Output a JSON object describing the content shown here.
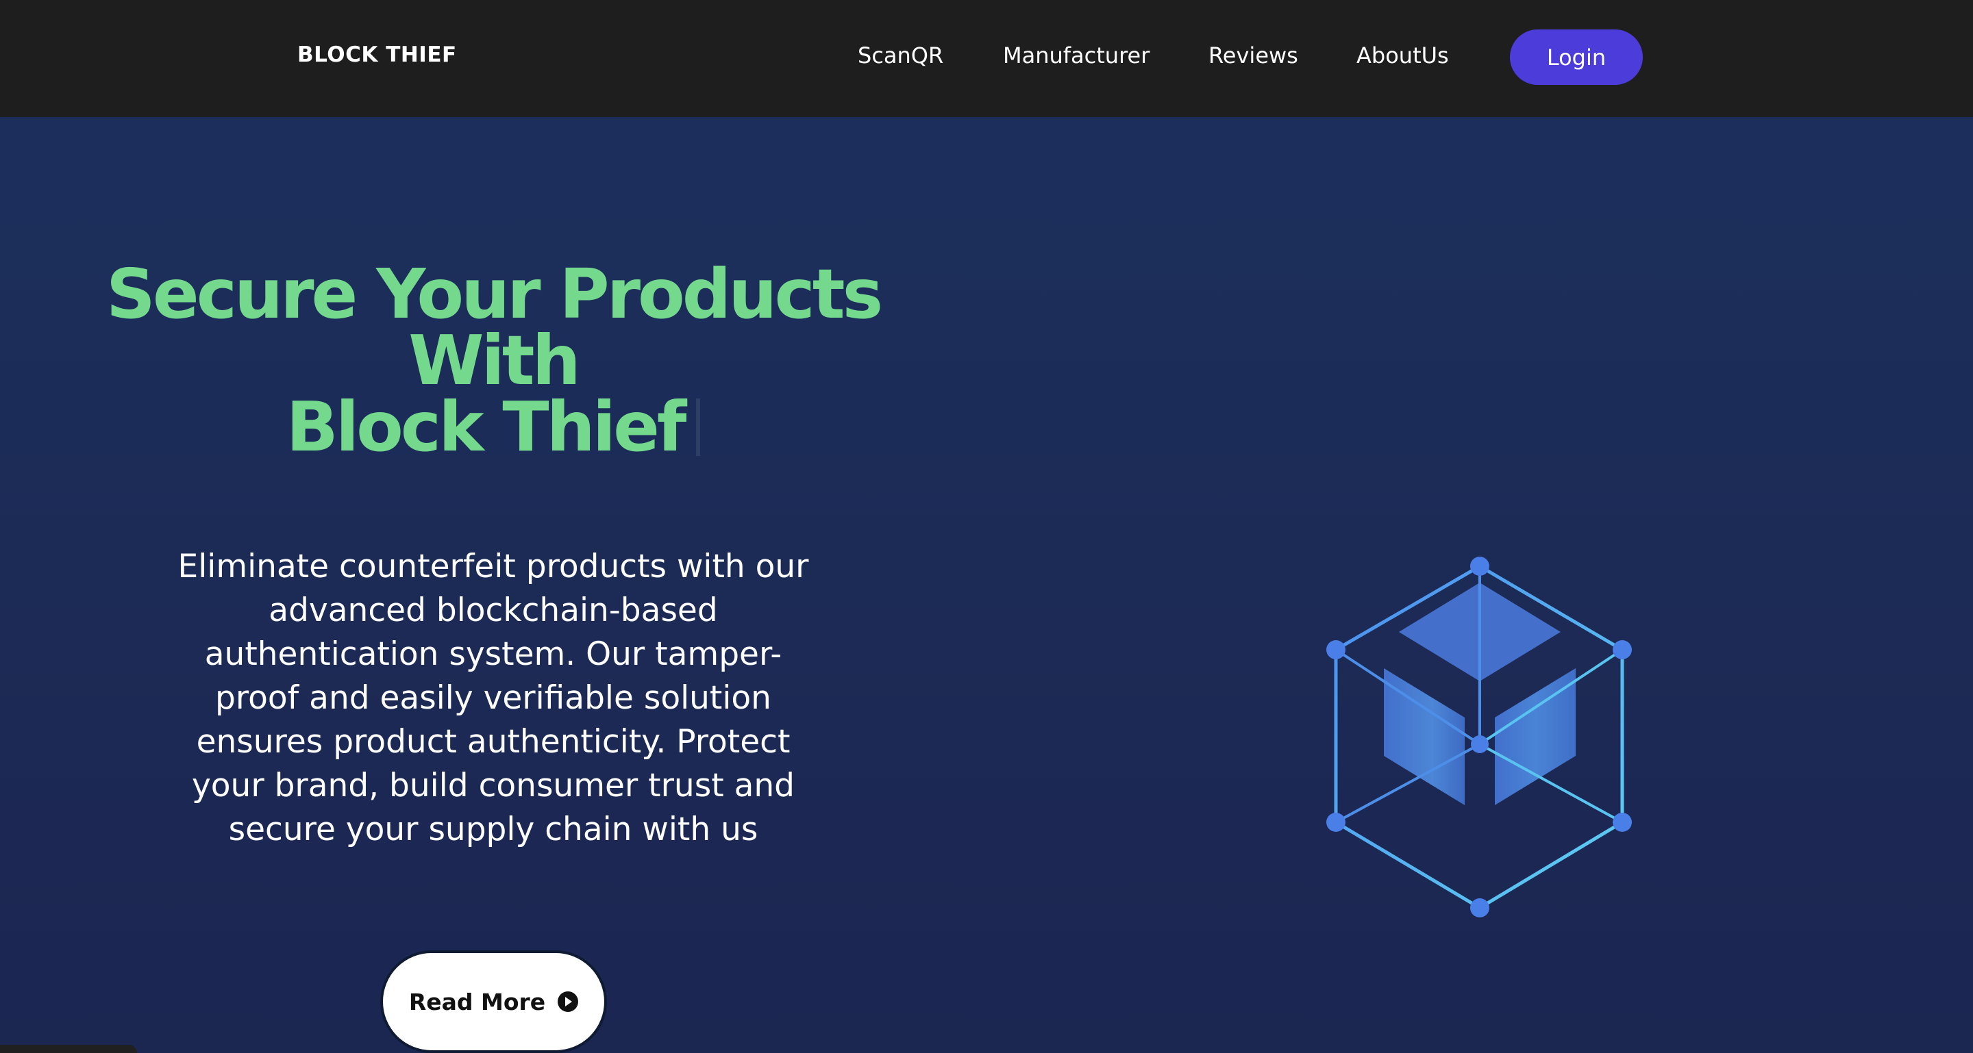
{
  "nav": {
    "brand": "BLOCK THIEF",
    "links": [
      "ScanQR",
      "Manufacturer",
      "Reviews",
      "AboutUs"
    ],
    "login_label": "Login"
  },
  "hero": {
    "title_line1": "Secure Your Products With",
    "title_line2": "Block Thief",
    "description": "Eliminate counterfeit products with our advanced blockchain-based authentication system. Our tamper-proof and easily verifiable solution ensures product authenticity. Protect your brand, build consumer trust and secure your supply chain with us",
    "cta_label": "Read More",
    "cta_icon": "play-circle-icon",
    "illustration": "blockchain-cube-icon"
  },
  "colors": {
    "nav_bg": "#1e1e1e",
    "hero_bg": "#1c2b56",
    "accent_green": "#74d98d",
    "login_purple": "#4c3ddb",
    "cube_blue": "#4472cc"
  }
}
